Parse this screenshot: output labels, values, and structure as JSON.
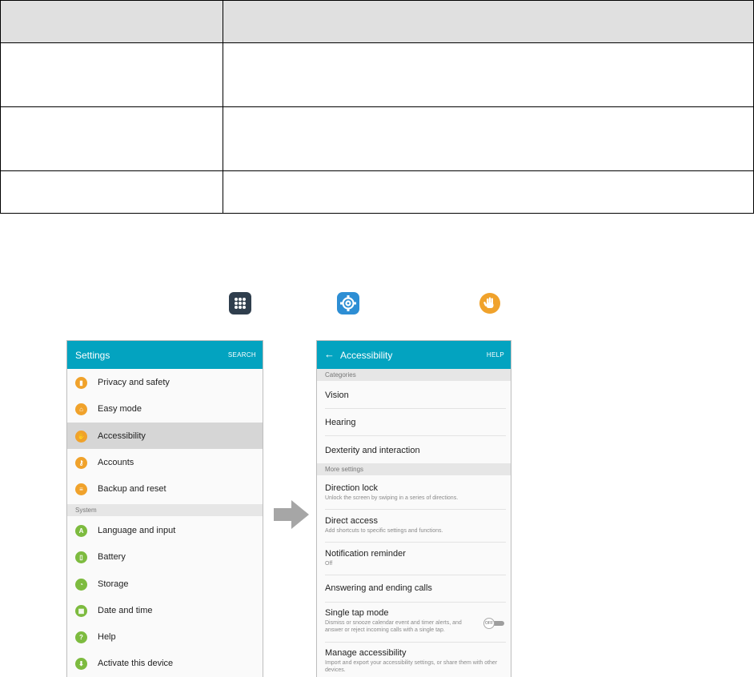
{
  "settings_screen": {
    "title": "Settings",
    "search_label": "SEARCH",
    "items": [
      {
        "label": "Privacy and safety",
        "icon": "privacy-icon",
        "color": "#f0a22b",
        "glyph": "▮"
      },
      {
        "label": "Easy mode",
        "icon": "home-icon",
        "color": "#f0a22b",
        "glyph": "⌂"
      },
      {
        "label": "Accessibility",
        "icon": "hand-icon",
        "color": "#f0a22b",
        "glyph": "✋"
      },
      {
        "label": "Accounts",
        "icon": "key-icon",
        "color": "#f0a22b",
        "glyph": "⚷"
      },
      {
        "label": "Backup and reset",
        "icon": "backup-icon",
        "color": "#f0a22b",
        "glyph": "≡"
      }
    ],
    "section_system": "System",
    "system_items": [
      {
        "label": "Language and input",
        "icon": "language-icon",
        "color": "#7dbb3f",
        "glyph": "A"
      },
      {
        "label": "Battery",
        "icon": "battery-icon",
        "color": "#7dbb3f",
        "glyph": "▯"
      },
      {
        "label": "Storage",
        "icon": "storage-icon",
        "color": "#7dbb3f",
        "glyph": "◔"
      },
      {
        "label": "Date and time",
        "icon": "calendar-icon",
        "color": "#7dbb3f",
        "glyph": "▦"
      },
      {
        "label": "Help",
        "icon": "help-icon",
        "color": "#7dbb3f",
        "glyph": "?"
      },
      {
        "label": "Activate this device",
        "icon": "activate-icon",
        "color": "#7dbb3f",
        "glyph": "⬇"
      }
    ]
  },
  "accessibility_screen": {
    "title": "Accessibility",
    "help_label": "HELP",
    "back_glyph": "←",
    "section_categories": "Categories",
    "categories": [
      "Vision",
      "Hearing",
      "Dexterity and interaction"
    ],
    "section_more": "More settings",
    "more_items": [
      {
        "label": "Direction lock",
        "sub": "Unlock the screen by swiping in a series of directions."
      },
      {
        "label": "Direct access",
        "sub": "Add shortcuts to specific settings and functions."
      },
      {
        "label": "Notification reminder",
        "sub": "Off"
      },
      {
        "label": "Answering and ending calls",
        "sub": ""
      },
      {
        "label": "Single tap mode",
        "sub": "Dismiss or snooze calendar event and timer alerts, and answer or reject incoming calls with a single tap.",
        "toggle": "OFF"
      },
      {
        "label": "Manage accessibility",
        "sub": "Import and export your accessibility settings, or share them with other devices."
      }
    ]
  },
  "colors": {
    "app_bar": "#03a3c0",
    "orange_icon": "#f0a22b",
    "green_icon": "#7dbb3f",
    "table_header": "#e0e0e0"
  }
}
